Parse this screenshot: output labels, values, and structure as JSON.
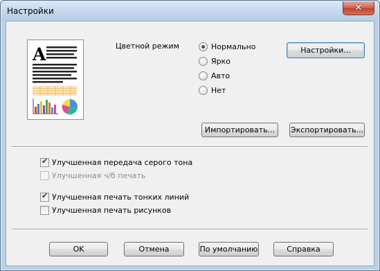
{
  "window": {
    "title": "Настройки"
  },
  "color_mode": {
    "label": "Цветной режим",
    "options": [
      {
        "label": "Нормально",
        "selected": true
      },
      {
        "label": "Ярко",
        "selected": false
      },
      {
        "label": "Авто",
        "selected": false
      },
      {
        "label": "Нет",
        "selected": false
      }
    ],
    "settings_button": "Настройки..."
  },
  "actions": {
    "import": "Импортировать...",
    "export": "Экспортировать..."
  },
  "options": [
    {
      "label": "Улучшенная передача серого тона",
      "checked": true,
      "enabled": true
    },
    {
      "label": "Улучшенная ч/б печать",
      "checked": false,
      "enabled": false
    },
    {
      "label": "Улучшенная печать тонких линий",
      "checked": true,
      "enabled": true
    },
    {
      "label": "Улучшенная печать рисунков",
      "checked": false,
      "enabled": true
    }
  ],
  "footer": {
    "ok": "OK",
    "cancel": "Отмена",
    "default": "По умолчанию",
    "help": "Справка"
  },
  "preview": {
    "letter": "A"
  }
}
